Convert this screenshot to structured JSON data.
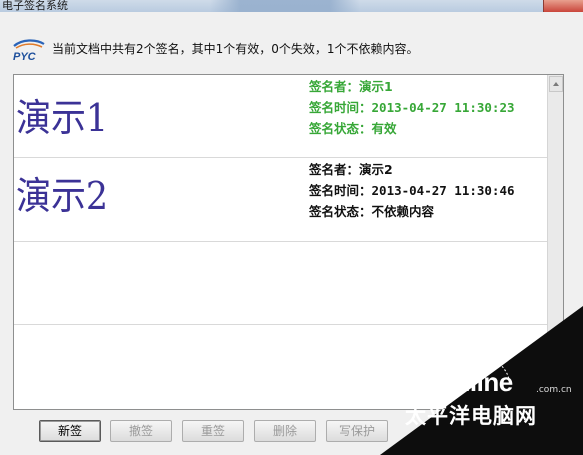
{
  "window": {
    "title": "电子签名系统"
  },
  "header": {
    "summary": "当前文档中共有2个签名，其中1个有效，0个失效，1个不依赖内容。"
  },
  "signatures": [
    {
      "image_text": "演示1",
      "signer_label": "签名者：",
      "signer": "演示1",
      "time_label": "签名时间：",
      "time": "2013-04-27 11:30:23",
      "status_label": "签名状态：",
      "status": "有效",
      "color": "#37a737"
    },
    {
      "image_text": "演示2",
      "signer_label": "签名者：",
      "signer": "演示2",
      "time_label": "签名时间：",
      "time": "2013-04-27 11:30:46",
      "status_label": "签名状态：",
      "status": "不依赖内容",
      "color": "#111111"
    }
  ],
  "toolbar": {
    "new_label": "新签",
    "revoke_label": "撤签",
    "resign_label": "重签",
    "delete_label": "删除",
    "protect_label": "写保护"
  },
  "watermark": {
    "brand": "PConline",
    "domain": ".com.cn",
    "cn": "太平洋电脑网"
  },
  "icons": {
    "logo": "pyc-logo-icon",
    "close": "close-icon",
    "scroll_up": "arrow-up-icon",
    "scroll_down": "arrow-down-icon"
  }
}
